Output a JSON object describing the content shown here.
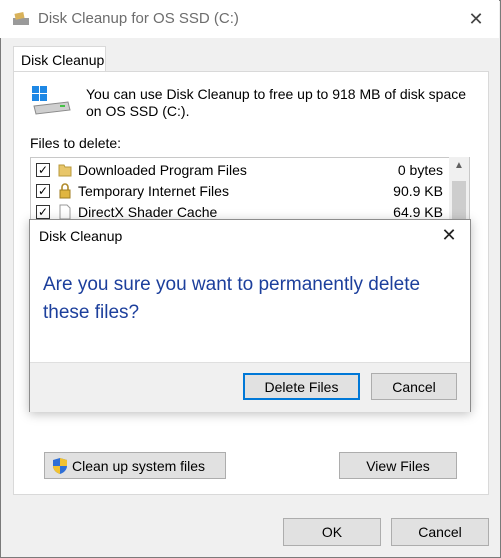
{
  "window": {
    "title": "Disk Cleanup for OS SSD (C:)",
    "close_glyph": "✕"
  },
  "tab": {
    "label": "Disk Cleanup"
  },
  "info": {
    "text": "You can use Disk Cleanup to free up to 918 MB of disk space on OS SSD (C:)."
  },
  "files_label": "Files to delete:",
  "files": [
    {
      "checked": true,
      "icon": "folder-icon",
      "name": "Downloaded Program Files",
      "size": "0 bytes"
    },
    {
      "checked": true,
      "icon": "lock-icon",
      "name": "Temporary Internet Files",
      "size": "90.9 KB"
    },
    {
      "checked": true,
      "icon": "file-icon",
      "name": "DirectX Shader Cache",
      "size": "64.9 KB"
    }
  ],
  "buttons": {
    "cleanup_system": "Clean up system files",
    "view_files": "View Files",
    "ok": "OK",
    "cancel": "Cancel"
  },
  "dialog": {
    "title": "Disk Cleanup",
    "message": "Are you sure you want to permanently delete these files?",
    "delete_label": "Delete Files",
    "cancel_label": "Cancel",
    "close_glyph": "✕"
  },
  "colors": {
    "accent": "#0078d7",
    "message": "#1c3f9c"
  }
}
